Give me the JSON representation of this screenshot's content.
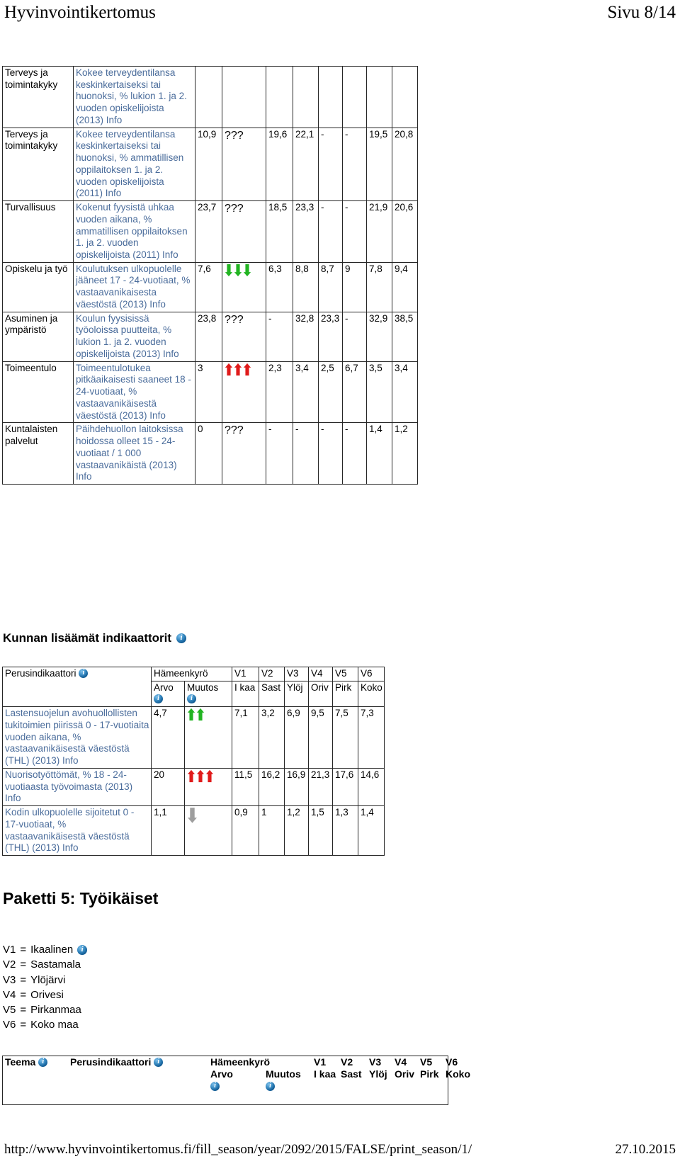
{
  "running_head": {
    "title": "Hyvinvointikertomus",
    "page": "Sivu 8/14"
  },
  "running_foot": {
    "url": "http://www.hyvinvointikertomus.fi/fill_season/year/2092/2015/FALSE/print_season/1/",
    "date": "27.10.2015"
  },
  "colors": {
    "link": "#4a6c9b",
    "up_red": "#e01b1b",
    "down_green": "#22b422",
    "up_green": "#22b422",
    "down_gray": "#9e9e9e",
    "info_blue": "#125d96",
    "border": "#262626"
  },
  "table1": {
    "rows": [
      {
        "teema": "Terveys ja toimintakyky",
        "indikaattori": "Kokee terveydentilansa keskinkertaiseksi tai huonoksi, % lukion 1. ja 2. vuoden opiskelijoista (2013) Info",
        "arvo": "",
        "muutos": {
          "kind": "none",
          "count": 0,
          "text": ""
        },
        "v": [
          "",
          "",
          "",
          "",
          "",
          ""
        ]
      },
      {
        "teema": "Terveys ja toimintakyky",
        "indikaattori": "Kokee terveydentilansa keskinkertaiseksi tai huonoksi, % ammatillisen oppilaitoksen 1. ja 2. vuoden opiskelijoista (2011) Info",
        "arvo": "10,9",
        "muutos": {
          "kind": "question",
          "count": 0,
          "text": "???"
        },
        "v": [
          "19,6",
          "22,1",
          "-",
          "-",
          "19,5",
          "20,8"
        ]
      },
      {
        "teema": "Turvallisuus",
        "indikaattori": "Kokenut fyysistä uhkaa vuoden aikana, % ammatillisen oppilaitoksen 1. ja 2. vuoden opiskelijoista (2011) Info",
        "arvo": "23,7",
        "muutos": {
          "kind": "question",
          "count": 0,
          "text": "???"
        },
        "v": [
          "18,5",
          "23,3",
          "-",
          "-",
          "21,9",
          "20,6"
        ]
      },
      {
        "teema": "Opiskelu ja työ",
        "indikaattori": "Koulutuksen ulkopuolelle jääneet 17 - 24-vuotiaat, % vastaavanikaisesta väestöstä (2013) Info",
        "arvo": "7,6",
        "muutos": {
          "kind": "down-green",
          "count": 3,
          "text": ""
        },
        "v": [
          "6,3",
          "8,8",
          "8,7",
          "9",
          "7,8",
          "9,4"
        ]
      },
      {
        "teema": "Asuminen ja ympäristö",
        "indikaattori": "Koulun fyysisissä työoloissa puutteita, % lukion 1. ja 2. vuoden opiskelijoista (2013) Info",
        "arvo": "23,8",
        "muutos": {
          "kind": "question",
          "count": 0,
          "text": "???"
        },
        "v": [
          "-",
          "32,8",
          "23,3",
          "-",
          "32,9",
          "38,5"
        ]
      },
      {
        "teema": "Toimeentulo",
        "indikaattori": "Toimeentulotukea pitkäaikaisesti saaneet 18 - 24-vuotiaat, % vastaavanikäisestä väestöstä (2013) Info",
        "arvo": "3",
        "muutos": {
          "kind": "up-red",
          "count": 3,
          "text": ""
        },
        "v": [
          "2,3",
          "3,4",
          "2,5",
          "6,7",
          "3,5",
          "3,4"
        ]
      },
      {
        "teema": "Kuntalaisten palvelut",
        "indikaattori": "Päihdehuollon laitoksissa hoidossa olleet 15 - 24-vuotiaat / 1 000 vastaavanikäistä (2013) Info",
        "arvo": "0",
        "muutos": {
          "kind": "question",
          "count": 0,
          "text": "???"
        },
        "v": [
          "-",
          "-",
          "-",
          "-",
          "1,4",
          "1,2"
        ]
      }
    ]
  },
  "section2": {
    "title": "Kunnan lisäämät indikaattorit",
    "info_icon": "info-icon"
  },
  "table2": {
    "header": {
      "indikaattori": "Perusindikaattori",
      "municipality": "Hämeenkyrö",
      "arvo": "Arvo",
      "muutos": "Muutos",
      "vcodes": [
        "V1",
        "V2",
        "V3",
        "V4",
        "V5",
        "V6"
      ],
      "vnames": [
        "I kaa",
        "Sast",
        "Ylöj",
        "Oriv",
        "Pirk",
        "Koko"
      ]
    },
    "rows": [
      {
        "indikaattori": "Lastensuojelun avohuollollisten tukitoimien piirissä 0 - 17-vuotiaita vuoden aikana, % vastaavanikäisestä väestöstä (THL) (2013) Info",
        "arvo": "4,7",
        "muutos": {
          "kind": "up-green",
          "count": 2,
          "text": ""
        },
        "v": [
          "7,1",
          "3,2",
          "6,9",
          "9,5",
          "7,5",
          "7,3"
        ]
      },
      {
        "indikaattori": "Nuorisotyöttömät, % 18 - 24-vuotiaasta työvoimasta (2013) Info",
        "arvo": "20",
        "muutos": {
          "kind": "up-red",
          "count": 3,
          "text": ""
        },
        "v": [
          "11,5",
          "16,2",
          "16,9",
          "21,3",
          "17,6",
          "14,6"
        ]
      },
      {
        "indikaattori": "Kodin ulkopuolelle sijoitetut 0 - 17-vuotiaat, % vastaavanikäisestä väestöstä (THL) (2013) Info",
        "arvo": "1,1",
        "muutos": {
          "kind": "down-gray",
          "count": 1,
          "text": ""
        },
        "v": [
          "0,9",
          "1",
          "1,2",
          "1,5",
          "1,3",
          "1,4"
        ]
      }
    ]
  },
  "paketti": {
    "title": "Paketti 5: Työikäiset"
  },
  "legend": {
    "items": [
      {
        "code": "V1",
        "eq": "=",
        "name": "Ikaalinen",
        "has_info": true
      },
      {
        "code": "V2",
        "eq": "=",
        "name": "Sastamala",
        "has_info": false
      },
      {
        "code": "V3",
        "eq": "=",
        "name": "Ylöjärvi",
        "has_info": false
      },
      {
        "code": "V4",
        "eq": "=",
        "name": "Orivesi",
        "has_info": false
      },
      {
        "code": "V5",
        "eq": "=",
        "name": "Pirkanmaa",
        "has_info": false
      },
      {
        "code": "V6",
        "eq": "=",
        "name": "Koko maa",
        "has_info": false
      }
    ]
  },
  "table3": {
    "header": {
      "teema": "Teema",
      "indikaattori": "Perusindikaattori",
      "municipality": "Hämeenkyrö",
      "arvo": "Arvo",
      "muutos": "Muutos",
      "vcodes": [
        "V1",
        "V2",
        "V3",
        "V4",
        "V5",
        "V6"
      ],
      "vnames": [
        "I kaa",
        "Sast",
        "Ylöj",
        "Oriv",
        "Pirk",
        "Koko"
      ]
    }
  }
}
